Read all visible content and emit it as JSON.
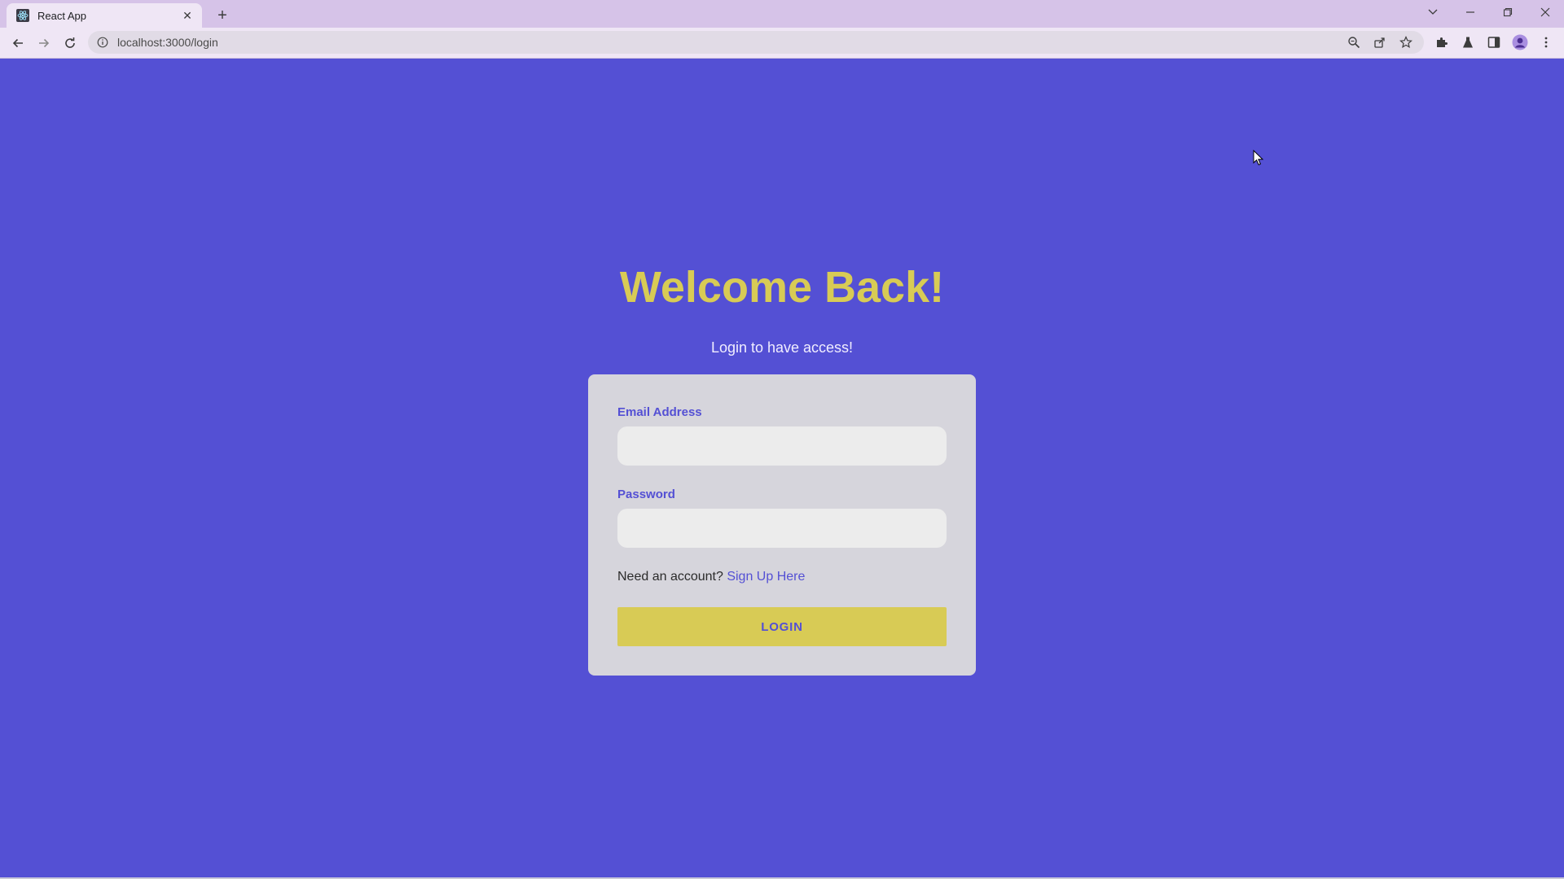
{
  "browser": {
    "tab": {
      "title": "React App",
      "favicon": "react-icon",
      "close_glyph": "✕"
    },
    "new_tab_glyph": "+",
    "url": "localhost:3000/login",
    "colors": {
      "tabstrip": "#d6c3e8",
      "toolbar": "#efe6f5"
    }
  },
  "page": {
    "title": "Welcome Back!",
    "subtitle": "Login to have access!",
    "colors": {
      "background": "#5450d4",
      "accent": "#d8cb55",
      "card": "#d6d5dc"
    },
    "form": {
      "email": {
        "label": "Email Address",
        "value": "",
        "placeholder": ""
      },
      "password": {
        "label": "Password",
        "value": "",
        "placeholder": ""
      },
      "signup_prompt": "Need an account?",
      "signup_link": "Sign Up Here",
      "submit_label": "LOGIN"
    }
  }
}
